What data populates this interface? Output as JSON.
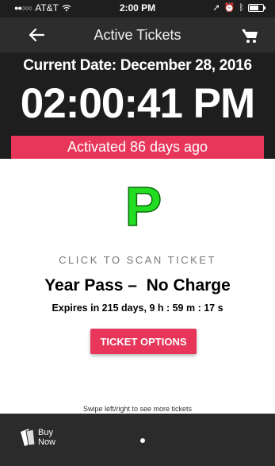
{
  "status_bar": {
    "carrier": "AT&T",
    "time": "2:00 PM"
  },
  "nav": {
    "title": "Active Tickets",
    "back_icon": "arrow-left-icon",
    "cart_icon": "cart-icon"
  },
  "clock": {
    "current_date": "Current Date: December 28, 2016",
    "current_time": "02:00:41 PM"
  },
  "activated_text": "Activated 86 days ago",
  "ticket": {
    "logo_letter": "P",
    "scan_label": "CLICK TO SCAN TICKET",
    "title": "Year Pass –  No Charge",
    "expiry": "Expires in 215 days, 9 h : 59 m : 17 s",
    "options_label": "TICKET OPTIONS"
  },
  "swipe_hint": "Swipe left/right to see more tickets",
  "bottom_bar": {
    "buy_now_label": "Buy Now",
    "page_count": 1,
    "current_page": 1
  },
  "colors": {
    "accent": "#e8365a",
    "header_bg": "#1e1e1e",
    "logo_green": "#22dd22"
  }
}
